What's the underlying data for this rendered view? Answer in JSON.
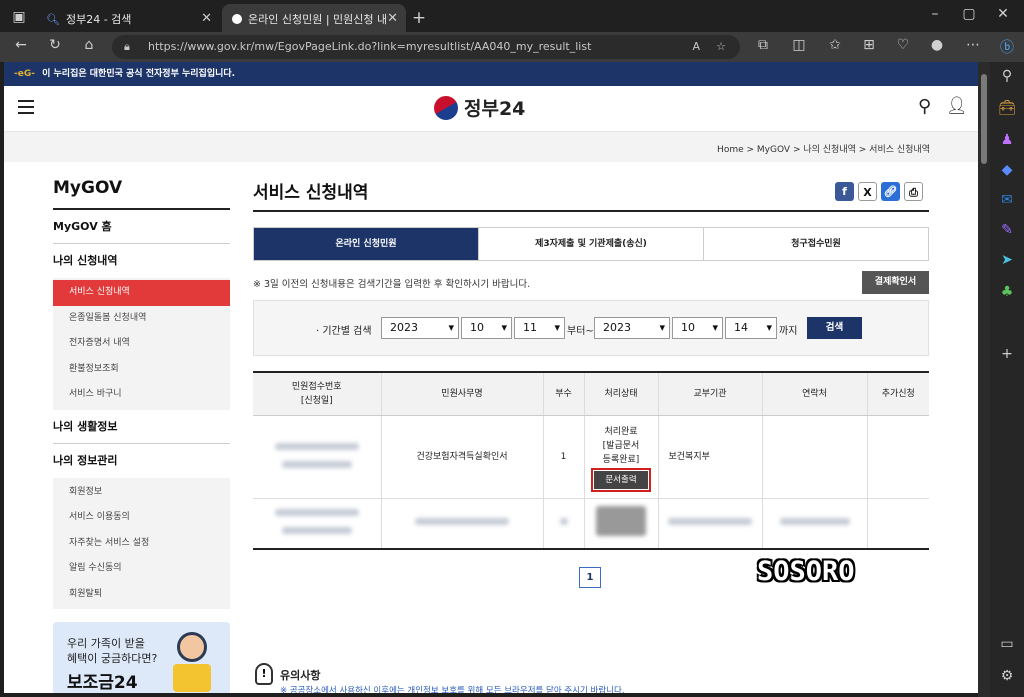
{
  "browser": {
    "tabs": [
      {
        "label": "정부24 - 검색"
      },
      {
        "label": "온라인 신청민원 | 민원신청 내역"
      }
    ],
    "url": "https://www.gov.kr/mw/EgovPageLink.do?link=myresultlist/AA040_my_result_list"
  },
  "banner": {
    "text": "이 누리집은 대한민국 공식 전자정부 누리집입니다."
  },
  "header": {
    "logo_text": "정부24"
  },
  "breadcrumb": [
    "Home",
    "MyGOV",
    "나의 신청내역",
    "서비스 신청내역"
  ],
  "lnb": {
    "title": "MyGOV",
    "home": "MyGOV 홈",
    "group1": "나의 신청내역",
    "group1_items": [
      "서비스 신청내역",
      "온종일돌봄 신청내역",
      "전자증명서 내역",
      "환불정보조회",
      "서비스 바구니"
    ],
    "group2": "나의 생활정보",
    "group3": "나의 정보관리",
    "group3_items": [
      "회원정보",
      "서비스 이용동의",
      "자주찾는 서비스 설정",
      "알림 수신동의",
      "회원탈퇴"
    ]
  },
  "promo": {
    "line1": "우리 가족이 받을",
    "line2": "혜택이 궁금하다면?",
    "title": "보조금24"
  },
  "main": {
    "title": "서비스 신청내역",
    "tabs": [
      "온라인 신청민원",
      "제3자제출 및 기관제출(송신)",
      "청구접수민원"
    ],
    "notice": "※ 3일 이전의 신청내용은 검색기간을 입력한 후 확인하시기 바랍니다.",
    "confirm_button": "결제확인서",
    "search": {
      "label": "· 기간별 검색",
      "from_year": "2023",
      "from_month": "10",
      "from_day": "11",
      "between": "부터~",
      "to_year": "2023",
      "to_month": "10",
      "to_day": "14",
      "until": "까지",
      "button": "검색"
    },
    "table": {
      "headers": [
        "민원접수번호\n[신청일]",
        "민원사무명",
        "부수",
        "처리상태",
        "교부기관",
        "연락처",
        "추가신청"
      ],
      "row1": {
        "service": "건강보험자격득실확인서",
        "copies": "1",
        "status": "처리완료\n[발급문서\n등록완료]",
        "print_button": "문서출력",
        "agency": "보건복지부"
      }
    },
    "page": "1",
    "watermark": "SOSORO",
    "notes_title": "유의사항",
    "notes_text": "※ 공공장소에서 사용하신 이후에는 개인정보 보호를 위해 모든 브라우저를 닫아 주시기 바랍니다."
  }
}
